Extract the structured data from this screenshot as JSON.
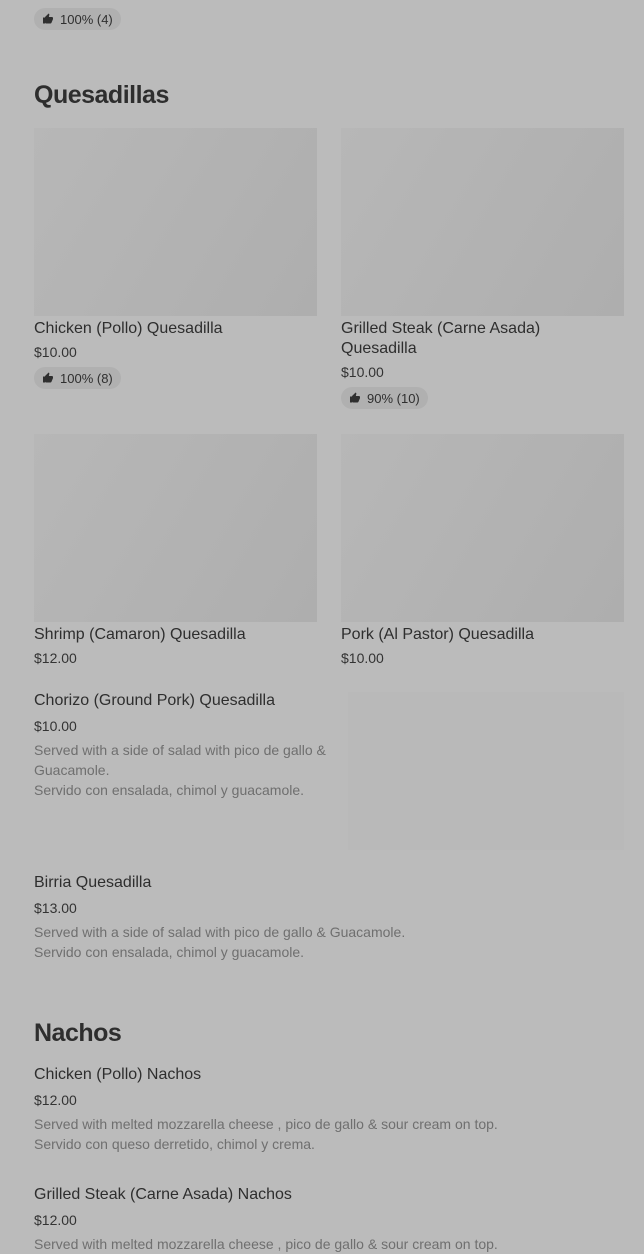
{
  "top_badge": {
    "rating": "100% (4)"
  },
  "sections": [
    {
      "title": "Quesadillas",
      "cards": [
        {
          "name": "Chicken (Pollo) Quesadilla",
          "price": "$10.00",
          "rating": "100% (8)"
        },
        {
          "name": "Grilled Steak (Carne Asada) Quesadilla",
          "price": "$10.00",
          "rating": "90% (10)"
        },
        {
          "name": "Shrimp (Camaron) Quesadilla",
          "price": "$12.00",
          "rating": ""
        },
        {
          "name": "Pork (Al Pastor) Quesadilla",
          "price": "$10.00",
          "rating": ""
        }
      ],
      "list_items": [
        {
          "name": "Chorizo (Ground Pork) Quesadilla",
          "price": "$10.00",
          "desc_line1": "Served with a side of salad with pico de gallo &",
          "desc_line2": "Guacamole.",
          "desc_line3": "Servido con ensalada, chimol y guacamole."
        },
        {
          "name": "Birria Quesadilla",
          "price": "$13.00",
          "desc_line1": "Served with a side of salad with pico de gallo & Guacamole.",
          "desc_line2": "Servido con ensalada, chimol y guacamole."
        }
      ]
    },
    {
      "title": "Nachos",
      "list_items": [
        {
          "name": "Chicken (Pollo) Nachos",
          "price": "$12.00",
          "desc_line1": "Served with melted mozzarella cheese , pico de gallo & sour cream on top.",
          "desc_line2": "Servido con queso derretido, chimol y crema."
        },
        {
          "name": "Grilled Steak (Carne Asada) Nachos",
          "price": "$12.00",
          "desc_line1": "Served with melted mozzarella cheese , pico de gallo & sour cream on top."
        }
      ]
    }
  ],
  "icons": {
    "rating": "thumbs-up-icon"
  }
}
